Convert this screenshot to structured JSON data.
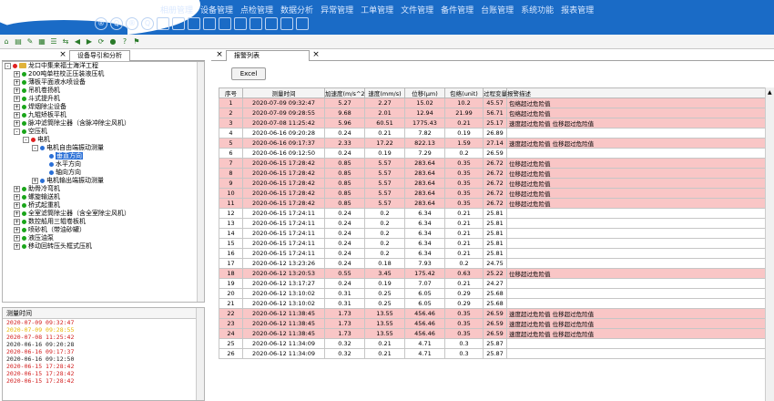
{
  "menu": [
    "相册管理",
    "设备管理",
    "点检管理",
    "数据分析",
    "异常管理",
    "工单管理",
    "文件管理",
    "备件管理",
    "台账管理",
    "系统功能",
    "报表管理"
  ],
  "quick_icons": [
    "®",
    "Q",
    "®",
    "Q"
  ],
  "left_tab": "设备导引和分析",
  "right_tab_1": "报警列表",
  "close_glyph": "×",
  "tree": [
    {
      "level": 0,
      "exp": "-",
      "dot": "red",
      "folder": true,
      "label": "龙口中集来福士海洋工程"
    },
    {
      "level": 1,
      "exp": "+",
      "dot": "green",
      "label": "200吨单柱校正压装液压机"
    },
    {
      "level": 1,
      "exp": "+",
      "dot": "green",
      "label": "薄板平面液水喷设备"
    },
    {
      "level": 1,
      "exp": "+",
      "dot": "green",
      "label": "吊机卷扬机"
    },
    {
      "level": 1,
      "exp": "+",
      "dot": "green",
      "label": "斗式提升机"
    },
    {
      "level": 1,
      "exp": "+",
      "dot": "green",
      "label": "焊烟除尘设备"
    },
    {
      "level": 1,
      "exp": "+",
      "dot": "green",
      "label": "九辊矫板平机"
    },
    {
      "level": 1,
      "exp": "+",
      "dot": "green",
      "label": "脉冲滤筒除尘器（含脉冲除尘风机）"
    },
    {
      "level": 1,
      "exp": "-",
      "dot": "green",
      "label": "空压机"
    },
    {
      "level": 2,
      "exp": "-",
      "dot": "red",
      "label": "电机"
    },
    {
      "level": 3,
      "exp": "-",
      "dot": "blue",
      "label": "电机自由端振动测量"
    },
    {
      "level": 4,
      "exp": "",
      "dot": "blue",
      "label": "垂直方向",
      "sel": true
    },
    {
      "level": 4,
      "exp": "",
      "dot": "blue",
      "label": "水平方向"
    },
    {
      "level": 4,
      "exp": "",
      "dot": "blue",
      "label": "轴向方向"
    },
    {
      "level": 3,
      "exp": "+",
      "dot": "blue",
      "label": "电机输出端振动测量"
    },
    {
      "level": 1,
      "exp": "+",
      "dot": "green",
      "label": "助骨冷弯机"
    },
    {
      "level": 1,
      "exp": "+",
      "dot": "green",
      "label": "螺旋输送机"
    },
    {
      "level": 1,
      "exp": "+",
      "dot": "green",
      "label": "桥式起重机"
    },
    {
      "level": 1,
      "exp": "+",
      "dot": "green",
      "label": "全室滤筒除尘器（含全室除尘风机）"
    },
    {
      "level": 1,
      "exp": "+",
      "dot": "green",
      "label": "数控船用三辊卷板机"
    },
    {
      "level": 1,
      "exp": "+",
      "dot": "green",
      "label": "喷砂机（带油砂罐）"
    },
    {
      "level": 1,
      "exp": "+",
      "dot": "green",
      "label": "液压油泵"
    },
    {
      "level": 1,
      "exp": "+",
      "dot": "green",
      "label": "移动回转压头框式压机"
    }
  ],
  "time_list": {
    "header": "测量时间",
    "rows": [
      {
        "t": "2020-07-09 09:32:47",
        "c": "#d21a1a"
      },
      {
        "t": "2020-07-09 09:28:55",
        "c": "#e8b800"
      },
      {
        "t": "2020-07-08 11:25:42",
        "c": "#d21a1a"
      },
      {
        "t": "2020-06-16 09:20:28",
        "c": "#222"
      },
      {
        "t": "2020-06-16 09:17:37",
        "c": "#d21a1a"
      },
      {
        "t": "2020-06-16 09:12:50",
        "c": "#222"
      },
      {
        "t": "2020-06-15 17:28:42",
        "c": "#d21a1a"
      },
      {
        "t": "2020-06-15 17:28:42",
        "c": "#d21a1a"
      },
      {
        "t": "2020-06-15 17:28:42",
        "c": "#d21a1a"
      }
    ]
  },
  "excel_label": "Excel",
  "grid": {
    "headers": [
      "序号",
      "测量时间",
      "加速度(m/s^2)",
      "速度(mm/s)",
      "位移(μm)",
      "包络(unit)",
      "过程变量",
      "报警描述"
    ],
    "rows": [
      {
        "c": [
          "1",
          "2020-07-09 09:32:47",
          "5.27",
          "2.27",
          "15.02",
          "10.2",
          "45.57",
          "包络超过危险值"
        ],
        "alarm": true
      },
      {
        "c": [
          "2",
          "2020-07-09 09:28:55",
          "9.68",
          "2.01",
          "12.94",
          "21.99",
          "56.71",
          "包络超过危险值"
        ],
        "alarm": true
      },
      {
        "c": [
          "3",
          "2020-07-08 11:25:42",
          "5.96",
          "60.51",
          "1775.43",
          "0.21",
          "25.17",
          "速度超过危险值 位移超过危险值"
        ],
        "alarm": true
      },
      {
        "c": [
          "4",
          "2020-06-16 09:20:28",
          "0.24",
          "0.21",
          "7.82",
          "0.19",
          "26.89",
          ""
        ],
        "alarm": false
      },
      {
        "c": [
          "5",
          "2020-06-16 09:17:37",
          "2.33",
          "17.22",
          "822.13",
          "1.59",
          "27.14",
          "速度超过危险值 位移超过危险值"
        ],
        "alarm": true
      },
      {
        "c": [
          "6",
          "2020-06-16 09:12:50",
          "0.24",
          "0.19",
          "7.29",
          "0.2",
          "26.59",
          ""
        ],
        "alarm": false
      },
      {
        "c": [
          "7",
          "2020-06-15 17:28:42",
          "0.85",
          "5.57",
          "283.64",
          "0.35",
          "26.72",
          "位移超过危险值"
        ],
        "alarm": true
      },
      {
        "c": [
          "8",
          "2020-06-15 17:28:42",
          "0.85",
          "5.57",
          "283.64",
          "0.35",
          "26.72",
          "位移超过危险值"
        ],
        "alarm": true
      },
      {
        "c": [
          "9",
          "2020-06-15 17:28:42",
          "0.85",
          "5.57",
          "283.64",
          "0.35",
          "26.72",
          "位移超过危险值"
        ],
        "alarm": true
      },
      {
        "c": [
          "10",
          "2020-06-15 17:28:42",
          "0.85",
          "5.57",
          "283.64",
          "0.35",
          "26.72",
          "位移超过危险值"
        ],
        "alarm": true
      },
      {
        "c": [
          "11",
          "2020-06-15 17:28:42",
          "0.85",
          "5.57",
          "283.64",
          "0.35",
          "26.72",
          "位移超过危险值"
        ],
        "alarm": true
      },
      {
        "c": [
          "12",
          "2020-06-15 17:24:11",
          "0.24",
          "0.2",
          "6.34",
          "0.21",
          "25.81",
          ""
        ],
        "alarm": false
      },
      {
        "c": [
          "13",
          "2020-06-15 17:24:11",
          "0.24",
          "0.2",
          "6.34",
          "0.21",
          "25.81",
          ""
        ],
        "alarm": false
      },
      {
        "c": [
          "14",
          "2020-06-15 17:24:11",
          "0.24",
          "0.2",
          "6.34",
          "0.21",
          "25.81",
          ""
        ],
        "alarm": false
      },
      {
        "c": [
          "15",
          "2020-06-15 17:24:11",
          "0.24",
          "0.2",
          "6.34",
          "0.21",
          "25.81",
          ""
        ],
        "alarm": false
      },
      {
        "c": [
          "16",
          "2020-06-15 17:24:11",
          "0.24",
          "0.2",
          "6.34",
          "0.21",
          "25.81",
          ""
        ],
        "alarm": false
      },
      {
        "c": [
          "17",
          "2020-06-12 13:23:26",
          "0.24",
          "0.18",
          "7.93",
          "0.2",
          "24.75",
          ""
        ],
        "alarm": false
      },
      {
        "c": [
          "18",
          "2020-06-12 13:20:53",
          "0.55",
          "3.45",
          "175.42",
          "0.63",
          "25.22",
          "位移超过危险值"
        ],
        "alarm": true
      },
      {
        "c": [
          "19",
          "2020-06-12 13:17:27",
          "0.24",
          "0.19",
          "7.07",
          "0.21",
          "24.27",
          ""
        ],
        "alarm": false
      },
      {
        "c": [
          "20",
          "2020-06-12 13:10:02",
          "0.31",
          "0.25",
          "6.05",
          "0.29",
          "25.68",
          ""
        ],
        "alarm": false
      },
      {
        "c": [
          "21",
          "2020-06-12 13:10:02",
          "0.31",
          "0.25",
          "6.05",
          "0.29",
          "25.68",
          ""
        ],
        "alarm": false
      },
      {
        "c": [
          "22",
          "2020-06-12 11:38:45",
          "1.73",
          "13.55",
          "456.46",
          "0.35",
          "26.59",
          "速度超过危险值 位移超过危险值"
        ],
        "alarm": true
      },
      {
        "c": [
          "23",
          "2020-06-12 11:38:45",
          "1.73",
          "13.55",
          "456.46",
          "0.35",
          "26.59",
          "速度超过危险值 位移超过危险值"
        ],
        "alarm": true
      },
      {
        "c": [
          "24",
          "2020-06-12 11:38:45",
          "1.73",
          "13.55",
          "456.46",
          "0.35",
          "26.59",
          "速度超过危险值 位移超过危险值"
        ],
        "alarm": true
      },
      {
        "c": [
          "25",
          "2020-06-12 11:34:09",
          "0.32",
          "0.21",
          "4.71",
          "0.3",
          "25.87",
          ""
        ],
        "alarm": false
      },
      {
        "c": [
          "26",
          "2020-06-12 11:34:09",
          "0.32",
          "0.21",
          "4.71",
          "0.3",
          "25.87",
          ""
        ],
        "alarm": false
      }
    ]
  },
  "colors": {
    "header_blue": "#1a6bc6",
    "alarm_row": "#f9c6c6",
    "selected": "#2a6fd6"
  }
}
